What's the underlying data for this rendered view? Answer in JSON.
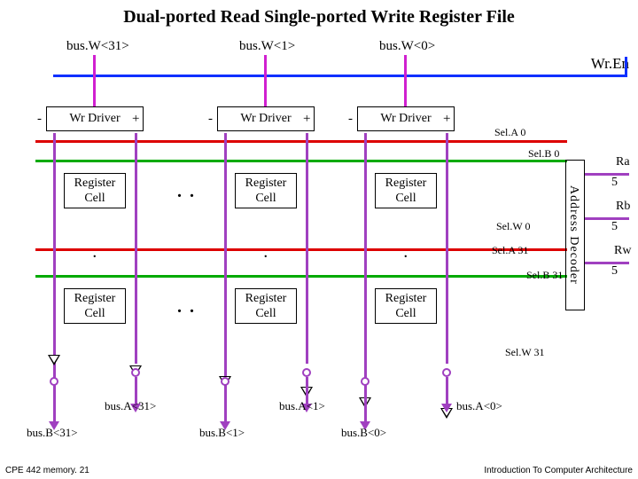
{
  "title": "Dual-ported Read Single-ported Write Register File",
  "busW": {
    "b31": "bus.W<31>",
    "b1": "bus.W<1>",
    "b0": "bus.W<0>"
  },
  "wrEn": "Wr.En",
  "driver": {
    "label": "Wr Driver",
    "minus": "-",
    "plus": "+"
  },
  "regcell": {
    "label": "Register\nCell"
  },
  "dotsH": ". .",
  "dotsV": ":",
  "sel": {
    "a0": "Sel.A 0",
    "b0": "Sel.B 0",
    "w0": "Sel.W 0",
    "a31": "Sel.A 31",
    "b31": "Sel.B 31",
    "w31": "Sel.W 31"
  },
  "decoder": "Address Decoder",
  "side": {
    "ra": "Ra",
    "rb": "Rb",
    "rw": "Rw",
    "five": "5"
  },
  "busA": {
    "b31": "bus.A<31>",
    "b1": "bus.A<1>",
    "b0": "bus.A<0>"
  },
  "busB": {
    "b31": "bus.B<31>",
    "b1": "bus.B<1>",
    "b0": "bus.B<0>"
  },
  "footer": {
    "left": "CPE 442 memory. 21",
    "right": "Introduction To Computer Architecture"
  }
}
